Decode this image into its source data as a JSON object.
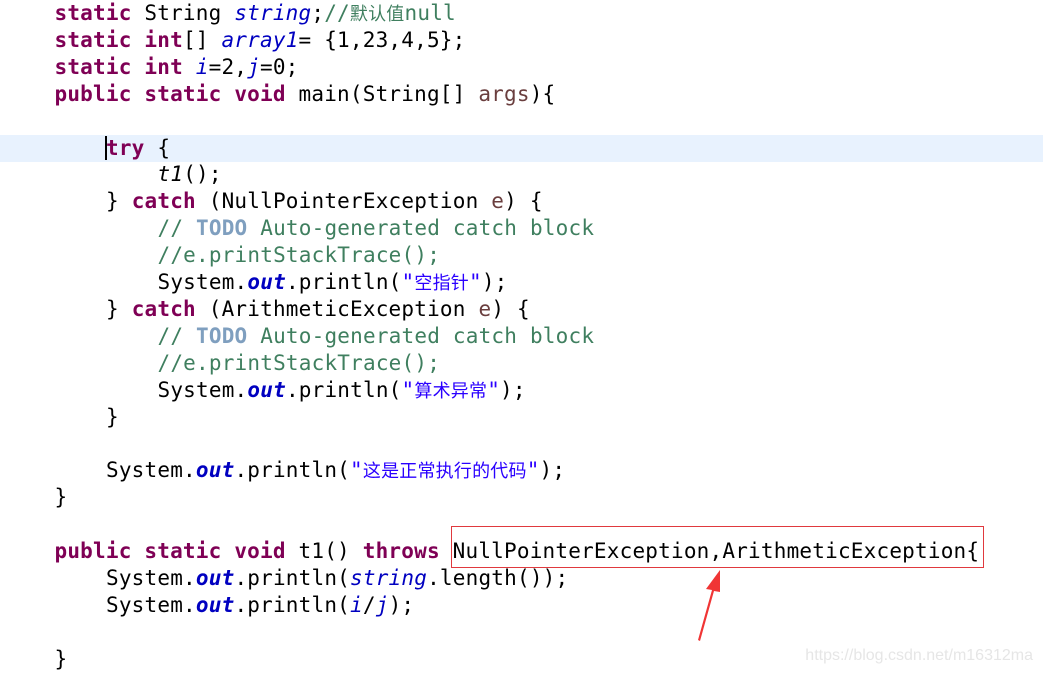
{
  "editor": {
    "language": "java",
    "current_line_index": 5,
    "lines": [
      {
        "indent": 1,
        "tokens": [
          {
            "t": "static",
            "c": "kw"
          },
          {
            "t": " String "
          },
          {
            "t": "string",
            "c": "field"
          },
          {
            "t": ";"
          },
          {
            "t": "//",
            "c": "comment"
          },
          {
            "t": "默认值",
            "c": "comment cjk"
          },
          {
            "t": "null",
            "c": "comment"
          }
        ]
      },
      {
        "indent": 1,
        "tokens": [
          {
            "t": "static",
            "c": "kw"
          },
          {
            "t": " "
          },
          {
            "t": "int",
            "c": "kw"
          },
          {
            "t": "[] "
          },
          {
            "t": "array1",
            "c": "field"
          },
          {
            "t": "= {1,23,4,5};"
          }
        ]
      },
      {
        "indent": 1,
        "tokens": [
          {
            "t": "static",
            "c": "kw"
          },
          {
            "t": " "
          },
          {
            "t": "int",
            "c": "kw"
          },
          {
            "t": " "
          },
          {
            "t": "i",
            "c": "field"
          },
          {
            "t": "=2,"
          },
          {
            "t": "j",
            "c": "field"
          },
          {
            "t": "=0;"
          }
        ]
      },
      {
        "indent": 1,
        "tokens": [
          {
            "t": "public",
            "c": "kw"
          },
          {
            "t": " "
          },
          {
            "t": "static",
            "c": "kw"
          },
          {
            "t": " "
          },
          {
            "t": "void",
            "c": "kw"
          },
          {
            "t": " main(String[] "
          },
          {
            "t": "args",
            "c": "local"
          },
          {
            "t": "){"
          }
        ]
      },
      {
        "indent": 0,
        "tokens": []
      },
      {
        "indent": 2,
        "tokens": [
          {
            "t": "try",
            "c": "kw"
          },
          {
            "t": " {"
          }
        ]
      },
      {
        "indent": 3,
        "tokens": [
          {
            "t": "t1",
            "c": "method-static"
          },
          {
            "t": "();"
          }
        ]
      },
      {
        "indent": 2,
        "tokens": [
          {
            "t": "} "
          },
          {
            "t": "catch",
            "c": "kw"
          },
          {
            "t": " (NullPointerException "
          },
          {
            "t": "e",
            "c": "local"
          },
          {
            "t": ") {"
          }
        ]
      },
      {
        "indent": 3,
        "tokens": [
          {
            "t": "// ",
            "c": "comment"
          },
          {
            "t": "TODO",
            "c": "todo"
          },
          {
            "t": " Auto-generated catch block",
            "c": "comment"
          }
        ]
      },
      {
        "indent": 3,
        "tokens": [
          {
            "t": "//e.printStackTrace();",
            "c": "comment"
          }
        ]
      },
      {
        "indent": 3,
        "tokens": [
          {
            "t": "System."
          },
          {
            "t": "out",
            "c": "sfield"
          },
          {
            "t": ".println("
          },
          {
            "t": "\"",
            "c": "str"
          },
          {
            "t": "空指针",
            "c": "str cjk"
          },
          {
            "t": "\"",
            "c": "str"
          },
          {
            "t": ");"
          }
        ]
      },
      {
        "indent": 2,
        "tokens": [
          {
            "t": "} "
          },
          {
            "t": "catch",
            "c": "kw"
          },
          {
            "t": " (ArithmeticException "
          },
          {
            "t": "e",
            "c": "local"
          },
          {
            "t": ") {"
          }
        ]
      },
      {
        "indent": 3,
        "tokens": [
          {
            "t": "// ",
            "c": "comment"
          },
          {
            "t": "TODO",
            "c": "todo"
          },
          {
            "t": " Auto-generated catch block",
            "c": "comment"
          }
        ]
      },
      {
        "indent": 3,
        "tokens": [
          {
            "t": "//e.printStackTrace();",
            "c": "comment"
          }
        ]
      },
      {
        "indent": 3,
        "tokens": [
          {
            "t": "System."
          },
          {
            "t": "out",
            "c": "sfield"
          },
          {
            "t": ".println("
          },
          {
            "t": "\"",
            "c": "str"
          },
          {
            "t": "算术异常",
            "c": "str cjk"
          },
          {
            "t": "\"",
            "c": "str"
          },
          {
            "t": ");"
          }
        ]
      },
      {
        "indent": 2,
        "tokens": [
          {
            "t": "}"
          }
        ]
      },
      {
        "indent": 0,
        "tokens": []
      },
      {
        "indent": 2,
        "tokens": [
          {
            "t": "System."
          },
          {
            "t": "out",
            "c": "sfield"
          },
          {
            "t": ".println("
          },
          {
            "t": "\"",
            "c": "str"
          },
          {
            "t": "这是正常执行的代码",
            "c": "str cjk"
          },
          {
            "t": "\"",
            "c": "str"
          },
          {
            "t": ");"
          }
        ]
      },
      {
        "indent": 1,
        "tokens": [
          {
            "t": "}"
          }
        ]
      },
      {
        "indent": 0,
        "tokens": []
      },
      {
        "indent": 1,
        "tokens": [
          {
            "t": "public",
            "c": "kw"
          },
          {
            "t": " "
          },
          {
            "t": "static",
            "c": "kw"
          },
          {
            "t": " "
          },
          {
            "t": "void",
            "c": "kw"
          },
          {
            "t": " t1() "
          },
          {
            "t": "throws",
            "c": "kw"
          },
          {
            "t": " NullPointerException,ArithmeticException{"
          }
        ]
      },
      {
        "indent": 2,
        "tokens": [
          {
            "t": "System."
          },
          {
            "t": "out",
            "c": "sfield"
          },
          {
            "t": ".println("
          },
          {
            "t": "string",
            "c": "field"
          },
          {
            "t": ".length());"
          }
        ]
      },
      {
        "indent": 2,
        "tokens": [
          {
            "t": "System."
          },
          {
            "t": "out",
            "c": "sfield"
          },
          {
            "t": ".println("
          },
          {
            "t": "i",
            "c": "field"
          },
          {
            "t": "/"
          },
          {
            "t": "j",
            "c": "field"
          },
          {
            "t": ");"
          }
        ]
      },
      {
        "indent": 0,
        "tokens": []
      },
      {
        "indent": 1,
        "tokens": [
          {
            "t": "}"
          }
        ]
      }
    ]
  },
  "annotation": {
    "highlighted_text": "NullPointerException,ArithmeticException",
    "color": "#e0393e",
    "arrow_icon": "red-arrow-icon"
  },
  "watermark": "https://blog.csdn.net/m16312ma"
}
